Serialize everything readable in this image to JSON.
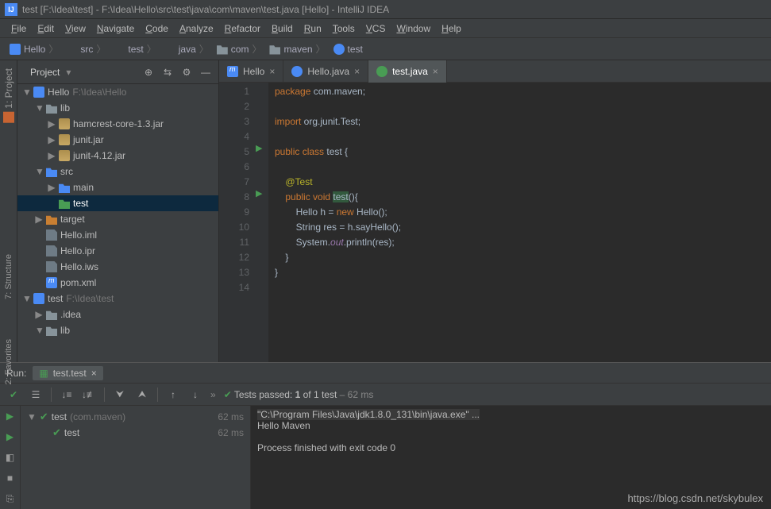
{
  "window": {
    "title": "test [F:\\Idea\\test] - F:\\Idea\\Hello\\src\\test\\java\\com\\maven\\test.java [Hello] - IntelliJ IDEA"
  },
  "menu": [
    "File",
    "Edit",
    "View",
    "Navigate",
    "Code",
    "Analyze",
    "Refactor",
    "Build",
    "Run",
    "Tools",
    "VCS",
    "Window",
    "Help"
  ],
  "breadcrumb": [
    {
      "icon": "module",
      "label": "Hello"
    },
    {
      "icon": "folder-blue",
      "label": "src"
    },
    {
      "icon": "green",
      "label": "test"
    },
    {
      "icon": "green",
      "label": "java"
    },
    {
      "icon": "folder",
      "label": "com"
    },
    {
      "icon": "folder",
      "label": "maven"
    },
    {
      "icon": "class",
      "label": "test"
    }
  ],
  "sidebar": {
    "title": "Project",
    "tools": [
      "target",
      "refresh",
      "gear",
      "collapse"
    ],
    "items": [
      {
        "depth": 0,
        "arrow": "▼",
        "icon": "module",
        "label": "Hello",
        "suffix": " F:\\Idea\\Hello"
      },
      {
        "depth": 1,
        "arrow": "▼",
        "icon": "folder",
        "label": "lib"
      },
      {
        "depth": 2,
        "arrow": "▶",
        "icon": "jar",
        "label": "hamcrest-core-1.3.jar"
      },
      {
        "depth": 2,
        "arrow": "▶",
        "icon": "jar",
        "label": "junit.jar"
      },
      {
        "depth": 2,
        "arrow": "▶",
        "icon": "jar",
        "label": "junit-4.12.jar"
      },
      {
        "depth": 1,
        "arrow": "▼",
        "icon": "folder-blue",
        "label": "src"
      },
      {
        "depth": 2,
        "arrow": "▶",
        "icon": "folder-blue",
        "label": "main"
      },
      {
        "depth": 2,
        "arrow": "",
        "icon": "green",
        "label": "test",
        "selected": true
      },
      {
        "depth": 1,
        "arrow": "▶",
        "icon": "folder-orange",
        "label": "target"
      },
      {
        "depth": 1,
        "arrow": "",
        "icon": "file",
        "label": "Hello.iml"
      },
      {
        "depth": 1,
        "arrow": "",
        "icon": "file",
        "label": "Hello.ipr"
      },
      {
        "depth": 1,
        "arrow": "",
        "icon": "file",
        "label": "Hello.iws"
      },
      {
        "depth": 1,
        "arrow": "",
        "icon": "m",
        "label": "pom.xml"
      },
      {
        "depth": 0,
        "arrow": "▼",
        "icon": "module",
        "label": "test",
        "suffix": " F:\\Idea\\test"
      },
      {
        "depth": 1,
        "arrow": "▶",
        "icon": "folder",
        "label": ".idea"
      },
      {
        "depth": 1,
        "arrow": "▼",
        "icon": "folder",
        "label": "lib"
      }
    ]
  },
  "tabs": [
    {
      "icon": "m",
      "label": "Hello",
      "active": false
    },
    {
      "icon": "c-blue",
      "label": "Hello.java",
      "active": false
    },
    {
      "icon": "c-green",
      "label": "test.java",
      "active": true
    }
  ],
  "code": {
    "lines": [
      {
        "n": 1,
        "html": "<span class='kw'>package</span> com.maven;"
      },
      {
        "n": 2,
        "html": ""
      },
      {
        "n": 3,
        "html": "<span class='kw'>import</span> org.junit.Test;"
      },
      {
        "n": 4,
        "html": ""
      },
      {
        "n": 5,
        "html": "<span class='kw'>public class</span> test {",
        "run": true
      },
      {
        "n": 6,
        "html": ""
      },
      {
        "n": 7,
        "html": "    <span class='ann'>@Test</span>"
      },
      {
        "n": 8,
        "html": "    <span class='kw'>public void</span> <span class='hl'>test</span>(){",
        "run": true
      },
      {
        "n": 9,
        "html": "        Hello h = <span class='kw'>new</span> Hello();"
      },
      {
        "n": 10,
        "html": "        String res = h.sayHello();"
      },
      {
        "n": 11,
        "html": "        System.<span class='field'>out</span>.println(res);"
      },
      {
        "n": 12,
        "html": "    }"
      },
      {
        "n": 13,
        "html": "}"
      },
      {
        "n": 14,
        "html": ""
      }
    ]
  },
  "run": {
    "label": "Run:",
    "tab": "test.test",
    "status_prefix": "Tests passed:",
    "status_count": "1",
    "status_mid": "of 1 test",
    "status_time": "– 62 ms",
    "tree": [
      {
        "depth": 0,
        "arrow": "▼",
        "label": "test",
        "suffix": "(com.maven)",
        "time": "62 ms"
      },
      {
        "depth": 1,
        "arrow": "",
        "label": "test",
        "suffix": "",
        "time": "62 ms"
      }
    ],
    "console": [
      {
        "cmd": true,
        "text": "\"C:\\Program Files\\Java\\jdk1.8.0_131\\bin\\java.exe\" ..."
      },
      {
        "text": "Hello Maven"
      },
      {
        "text": ""
      },
      {
        "text": "Process finished with exit code 0"
      }
    ]
  },
  "left_tabs": [
    {
      "label": "1: Project"
    },
    {
      "label": "7: Structure"
    },
    {
      "label": "2: Favorites"
    }
  ],
  "watermark": "https://blog.csdn.net/skybulex"
}
